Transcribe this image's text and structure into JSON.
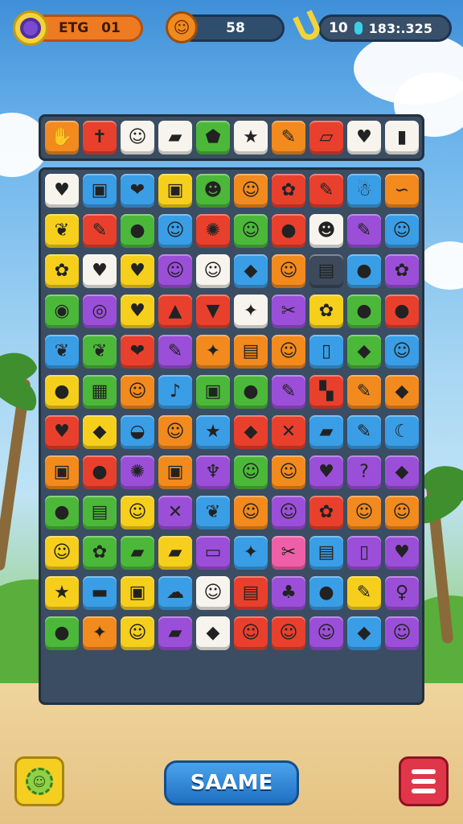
{
  "hud": {
    "level_label": "ETG",
    "level_value": "01",
    "level_icon": "target-icon",
    "coins_value": "58",
    "coins_icon": "orange-fruit-icon",
    "bananas_value": "10",
    "score_value": "183:.325",
    "banana_icon": "banana-icon"
  },
  "colors": {
    "red": "#e8402c",
    "orange": "#f28a1e",
    "yellow": "#f6cf1c",
    "green": "#4cb83a",
    "blue": "#3a9ee6",
    "purple": "#9b4fd8",
    "white": "#f7f4ee",
    "pink": "#ef5fa7",
    "dark": "#3c4a5c"
  },
  "top_row": [
    {
      "color": "orange",
      "glyph": "✋"
    },
    {
      "color": "red",
      "glyph": "✝"
    },
    {
      "color": "white",
      "glyph": "☺"
    },
    {
      "color": "white",
      "glyph": "▰"
    },
    {
      "color": "green",
      "glyph": "⬟"
    },
    {
      "color": "white",
      "glyph": "★"
    },
    {
      "color": "orange",
      "glyph": "✎"
    },
    {
      "color": "red",
      "glyph": "▱"
    },
    {
      "color": "white",
      "glyph": "♥"
    },
    {
      "color": "white",
      "glyph": "▮"
    }
  ],
  "board_tiles": [
    {
      "color": "white",
      "glyph": "♥"
    },
    {
      "color": "blue",
      "glyph": "▣"
    },
    {
      "color": "blue",
      "glyph": "❤"
    },
    {
      "color": "yellow",
      "glyph": "▣"
    },
    {
      "color": "green",
      "glyph": "☻"
    },
    {
      "color": "orange",
      "glyph": "☺"
    },
    {
      "color": "red",
      "glyph": "✿"
    },
    {
      "color": "red",
      "glyph": "✎"
    },
    {
      "color": "blue",
      "glyph": "☃"
    },
    {
      "color": "orange",
      "glyph": "∽"
    },
    {
      "color": "yellow",
      "glyph": "❦"
    },
    {
      "color": "red",
      "glyph": "✎"
    },
    {
      "color": "green",
      "glyph": "●"
    },
    {
      "color": "blue",
      "glyph": "☺"
    },
    {
      "color": "red",
      "glyph": "✺"
    },
    {
      "color": "green",
      "glyph": "☺"
    },
    {
      "color": "red",
      "glyph": "●"
    },
    {
      "color": "white",
      "glyph": "☻"
    },
    {
      "color": "purple",
      "glyph": "✎"
    },
    {
      "color": "blue",
      "glyph": "☺"
    },
    {
      "color": "yellow",
      "glyph": "✿"
    },
    {
      "color": "white",
      "glyph": "♥"
    },
    {
      "color": "yellow",
      "glyph": "♥"
    },
    {
      "color": "purple",
      "glyph": "☺"
    },
    {
      "color": "white",
      "glyph": "☺"
    },
    {
      "color": "blue",
      "glyph": "◆"
    },
    {
      "color": "orange",
      "glyph": "☺"
    },
    {
      "color": "dark",
      "glyph": "▤"
    },
    {
      "color": "blue",
      "glyph": "●"
    },
    {
      "color": "purple",
      "glyph": "✿"
    },
    {
      "color": "green",
      "glyph": "◉"
    },
    {
      "color": "purple",
      "glyph": "◎"
    },
    {
      "color": "yellow",
      "glyph": "♥"
    },
    {
      "color": "red",
      "glyph": "▲"
    },
    {
      "color": "red",
      "glyph": "▼"
    },
    {
      "color": "white",
      "glyph": "✦"
    },
    {
      "color": "purple",
      "glyph": "✂"
    },
    {
      "color": "yellow",
      "glyph": "✿"
    },
    {
      "color": "green",
      "glyph": "●"
    },
    {
      "color": "red",
      "glyph": "●"
    },
    {
      "color": "blue",
      "glyph": "❦"
    },
    {
      "color": "green",
      "glyph": "❦"
    },
    {
      "color": "red",
      "glyph": "❤"
    },
    {
      "color": "purple",
      "glyph": "✎"
    },
    {
      "color": "orange",
      "glyph": "✦"
    },
    {
      "color": "orange",
      "glyph": "▤"
    },
    {
      "color": "orange",
      "glyph": "☺"
    },
    {
      "color": "blue",
      "glyph": "▯"
    },
    {
      "color": "green",
      "glyph": "◆"
    },
    {
      "color": "blue",
      "glyph": "☺"
    },
    {
      "color": "yellow",
      "glyph": "●"
    },
    {
      "color": "green",
      "glyph": "▦"
    },
    {
      "color": "orange",
      "glyph": "☺"
    },
    {
      "color": "blue",
      "glyph": "♪"
    },
    {
      "color": "green",
      "glyph": "▣"
    },
    {
      "color": "green",
      "glyph": "●"
    },
    {
      "color": "purple",
      "glyph": "✎"
    },
    {
      "color": "red",
      "glyph": "▚"
    },
    {
      "color": "orange",
      "glyph": "✎"
    },
    {
      "color": "orange",
      "glyph": "◆"
    },
    {
      "color": "red",
      "glyph": "♥"
    },
    {
      "color": "yellow",
      "glyph": "◆"
    },
    {
      "color": "blue",
      "glyph": "◒"
    },
    {
      "color": "orange",
      "glyph": "☺"
    },
    {
      "color": "blue",
      "glyph": "★"
    },
    {
      "color": "red",
      "glyph": "◆"
    },
    {
      "color": "red",
      "glyph": "✕"
    },
    {
      "color": "blue",
      "glyph": "▰"
    },
    {
      "color": "blue",
      "glyph": "✎"
    },
    {
      "color": "blue",
      "glyph": "☾"
    },
    {
      "color": "orange",
      "glyph": "▣"
    },
    {
      "color": "red",
      "glyph": "●"
    },
    {
      "color": "purple",
      "glyph": "✺"
    },
    {
      "color": "orange",
      "glyph": "▣"
    },
    {
      "color": "purple",
      "glyph": "♆"
    },
    {
      "color": "green",
      "glyph": "☺"
    },
    {
      "color": "orange",
      "glyph": "☺"
    },
    {
      "color": "purple",
      "glyph": "♥"
    },
    {
      "color": "purple",
      "glyph": "?"
    },
    {
      "color": "purple",
      "glyph": "◆"
    },
    {
      "color": "green",
      "glyph": "●"
    },
    {
      "color": "green",
      "glyph": "▤"
    },
    {
      "color": "yellow",
      "glyph": "☺"
    },
    {
      "color": "purple",
      "glyph": "✕"
    },
    {
      "color": "blue",
      "glyph": "❦"
    },
    {
      "color": "orange",
      "glyph": "☺"
    },
    {
      "color": "purple",
      "glyph": "☺"
    },
    {
      "color": "red",
      "glyph": "✿"
    },
    {
      "color": "orange",
      "glyph": "☺"
    },
    {
      "color": "orange",
      "glyph": "☺"
    },
    {
      "color": "yellow",
      "glyph": "☺"
    },
    {
      "color": "green",
      "glyph": "✿"
    },
    {
      "color": "green",
      "glyph": "▰"
    },
    {
      "color": "yellow",
      "glyph": "▰"
    },
    {
      "color": "purple",
      "glyph": "▭"
    },
    {
      "color": "blue",
      "glyph": "✦"
    },
    {
      "color": "pink",
      "glyph": "✂"
    },
    {
      "color": "blue",
      "glyph": "▤"
    },
    {
      "color": "purple",
      "glyph": "▯"
    },
    {
      "color": "purple",
      "glyph": "♥"
    },
    {
      "color": "yellow",
      "glyph": "★"
    },
    {
      "color": "blue",
      "glyph": "▬"
    },
    {
      "color": "yellow",
      "glyph": "▣"
    },
    {
      "color": "blue",
      "glyph": "☁"
    },
    {
      "color": "white",
      "glyph": "☺"
    },
    {
      "color": "red",
      "glyph": "▤"
    },
    {
      "color": "purple",
      "glyph": "♣"
    },
    {
      "color": "blue",
      "glyph": "●"
    },
    {
      "color": "yellow",
      "glyph": "✎"
    },
    {
      "color": "purple",
      "glyph": "♀"
    },
    {
      "color": "green",
      "glyph": "●"
    },
    {
      "color": "orange",
      "glyph": "✦"
    },
    {
      "color": "yellow",
      "glyph": "☺"
    },
    {
      "color": "purple",
      "glyph": "▰"
    },
    {
      "color": "white",
      "glyph": "◆"
    },
    {
      "color": "red",
      "glyph": "☺"
    },
    {
      "color": "red",
      "glyph": "☺"
    },
    {
      "color": "purple",
      "glyph": "☺"
    },
    {
      "color": "blue",
      "glyph": "◆"
    },
    {
      "color": "purple",
      "glyph": "☺"
    }
  ],
  "bottom": {
    "settings_icon": "gear-face-icon",
    "center_button_label": "SAAME",
    "menu_icon": "menu-icon"
  }
}
